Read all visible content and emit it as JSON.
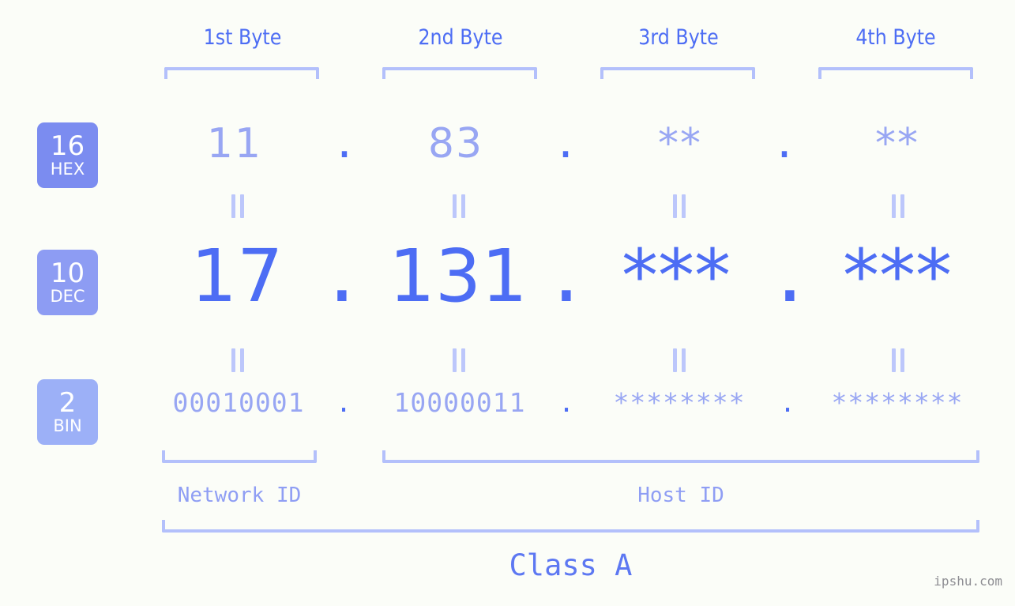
{
  "page": {
    "background_color": "#fbfdf8",
    "accent_color": "#4d6df4",
    "accent_light_color": "#98a6f3",
    "bracket_color": "#b3c0fb",
    "watermark": "ipshu.com"
  },
  "byte_headers": [
    {
      "label": "1st Byte"
    },
    {
      "label": "2nd Byte"
    },
    {
      "label": "3rd Byte"
    },
    {
      "label": "4th Byte"
    }
  ],
  "rows": [
    {
      "badge_number": "16",
      "badge_name": "HEX",
      "badge_color": "#7b8cf0",
      "values": [
        "11",
        "83",
        "**",
        "**"
      ],
      "separator": "."
    },
    {
      "badge_number": "10",
      "badge_name": "DEC",
      "badge_color": "#8d9cf3",
      "values": [
        "17",
        "131",
        "***",
        "***"
      ],
      "separator": "."
    },
    {
      "badge_number": "2",
      "badge_name": "BIN",
      "badge_color": "#9cb0f7",
      "values": [
        "00010001",
        "10000011",
        "********",
        "********"
      ],
      "separator": "."
    }
  ],
  "footer": {
    "network_id_label": "Network ID",
    "host_id_label": "Host ID",
    "class_label": "Class A"
  }
}
